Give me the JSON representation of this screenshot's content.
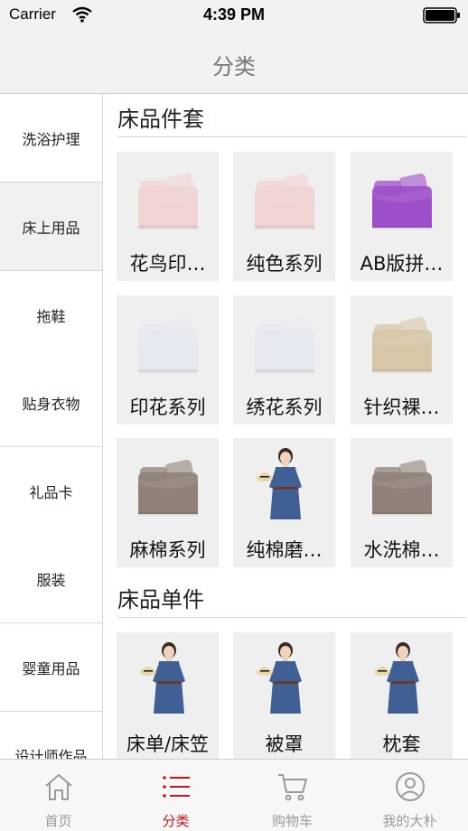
{
  "status_bar": {
    "carrier": "Carrier",
    "time": "4:39 PM"
  },
  "nav": {
    "title": "分类"
  },
  "sidebar": {
    "items": [
      {
        "label": "洗浴护理",
        "active": false
      },
      {
        "label": "床上用品",
        "active": true
      },
      {
        "label": "拖鞋",
        "active": false
      },
      {
        "label": "贴身衣物",
        "active": false
      },
      {
        "label": "礼品卡",
        "active": false
      },
      {
        "label": "服装",
        "active": false
      },
      {
        "label": "婴童用品",
        "active": false
      },
      {
        "label": "设计师作品",
        "active": false
      }
    ]
  },
  "sections": [
    {
      "title": "床品件套",
      "products": [
        {
          "label": "花鸟印…",
          "image": "pink-bedding-set"
        },
        {
          "label": "纯色系列",
          "image": "pink-bedding-set"
        },
        {
          "label": "AB版拼…",
          "image": "purple-bedding-set"
        },
        {
          "label": "印花系列",
          "image": "white-plaid-bedding-set"
        },
        {
          "label": "绣花系列",
          "image": "white-plaid-bedding-set"
        },
        {
          "label": "针织裸…",
          "image": "beige-bedding-set"
        },
        {
          "label": "麻棉系列",
          "image": "taupe-bedding-set"
        },
        {
          "label": "纯棉磨…",
          "image": "model-in-denim-dress"
        },
        {
          "label": "水洗棉…",
          "image": "taupe-bedding-set"
        }
      ]
    },
    {
      "title": "床品单件",
      "products": [
        {
          "label": "床单/床笠",
          "image": "model-in-denim-dress"
        },
        {
          "label": "被罩",
          "image": "model-in-denim-dress"
        },
        {
          "label": "枕套",
          "image": "model-in-denim-dress"
        }
      ]
    }
  ],
  "tab_bar": {
    "items": [
      {
        "label": "首页",
        "icon": "home-icon",
        "active": false
      },
      {
        "label": "分类",
        "icon": "list-icon",
        "active": true
      },
      {
        "label": "购物车",
        "icon": "cart-icon",
        "active": false
      },
      {
        "label": "我的大朴",
        "icon": "user-icon",
        "active": false
      }
    ]
  },
  "colors": {
    "accent": "#c4161c",
    "bar_background": "#f2f2f2",
    "card_background": "#efefef",
    "inactive_tab": "#9a9a9a"
  }
}
